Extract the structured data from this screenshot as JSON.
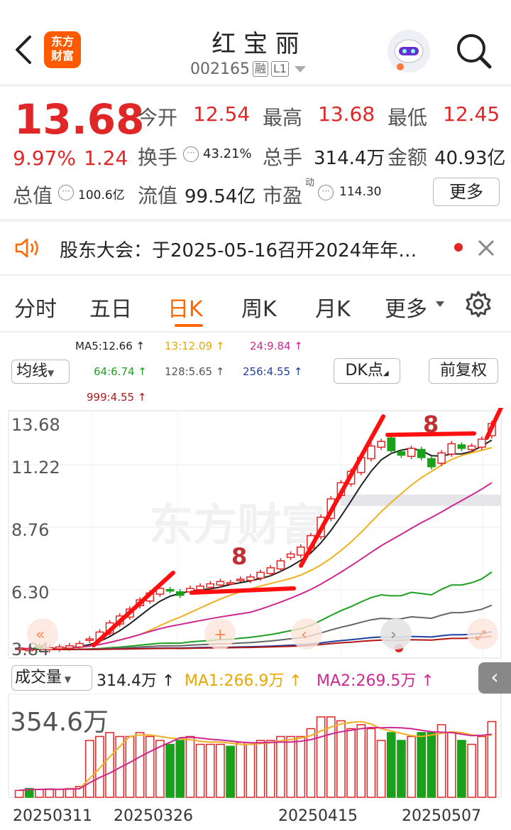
{
  "header": {
    "title": "红 宝 丽",
    "code": "002165",
    "badge_rong": "融",
    "badge_level": "L1",
    "logo_line1": "东方",
    "logo_line2": "财富"
  },
  "quote": {
    "price": "13.68",
    "change_pct": "9.97%",
    "change": "1.24",
    "open_label": "今开",
    "open": "12.54",
    "high_label": "最高",
    "high": "13.68",
    "low_label": "最低",
    "low": "12.45",
    "turnover_label": "换手",
    "turnover": "43.21%",
    "volume_label": "总手",
    "volume": "314.4万",
    "amount_label": "金额",
    "amount": "40.93亿",
    "mcap_label": "总值",
    "mcap": "100.6亿",
    "float_label": "流值",
    "float": "99.54亿",
    "pe_label": "市盈",
    "pe_sup": "动",
    "pe": "114.30",
    "more_button": "更多"
  },
  "notice": {
    "text": "股东大会：于2025-05-16召开2024年年…"
  },
  "tabs": [
    {
      "label": "分时",
      "active": false
    },
    {
      "label": "五日",
      "active": false
    },
    {
      "label": "日K",
      "active": true
    },
    {
      "label": "周K",
      "active": false
    },
    {
      "label": "月K",
      "active": false
    },
    {
      "label": "更多",
      "active": false
    }
  ],
  "ma_bar": {
    "selector": "均线",
    "ma5": "MA5:12.66 ↑",
    "ma13": "13:12.09 ↑",
    "ma24": "24:9.84 ↑",
    "ma64": "64:6.74 ↑",
    "ma128": "128:5.65 ↑",
    "ma256": "256:4.55 ↑",
    "ma999": "999:4.55 ↑",
    "dk_button": "DK点",
    "fq_button": "前复权"
  },
  "chart_data": {
    "type": "candlestick",
    "price_axis_labels": [
      "13.68",
      "11.22",
      "8.76",
      "6.30",
      "3.84"
    ],
    "ylim": [
      3.84,
      13.68
    ],
    "candles_close": [
      3.9,
      3.85,
      3.88,
      3.92,
      3.95,
      4.0,
      4.1,
      4.3,
      4.6,
      5.0,
      5.3,
      5.6,
      6.0,
      6.3,
      6.5,
      6.4,
      6.2,
      6.5,
      6.6,
      6.7,
      6.8,
      6.75,
      6.9,
      7.0,
      7.2,
      7.4,
      7.7,
      8.0,
      8.3,
      8.8,
      9.6,
      10.4,
      11.1,
      11.6,
      12.2,
      12.7,
      12.9,
      12.5,
      12.3,
      12.6,
      12.2,
      11.8,
      12.4,
      12.8,
      12.6,
      12.7,
      13.0,
      13.68
    ],
    "annotation_labels": [
      "8",
      "8"
    ],
    "volume_panel": {
      "selector": "成交量",
      "vol": "314.4万 ↑",
      "ma1": "MA1:266.9万 ↑",
      "ma2": "MA2:269.5万 ↑",
      "axis_top": "354.6万"
    },
    "x_labels": [
      "20250311",
      "20250326",
      "20250415",
      "20250507"
    ],
    "watermark": "东方财富"
  },
  "colors": {
    "up": "#e02626",
    "down": "#1aa01a",
    "accent": "#ff6600",
    "ma5": "#222222",
    "ma13": "#f0b020",
    "ma24": "#d02890",
    "ma64": "#20a020",
    "ma128": "#666666",
    "ma256": "#2040a0",
    "ma999": "#b01818"
  }
}
